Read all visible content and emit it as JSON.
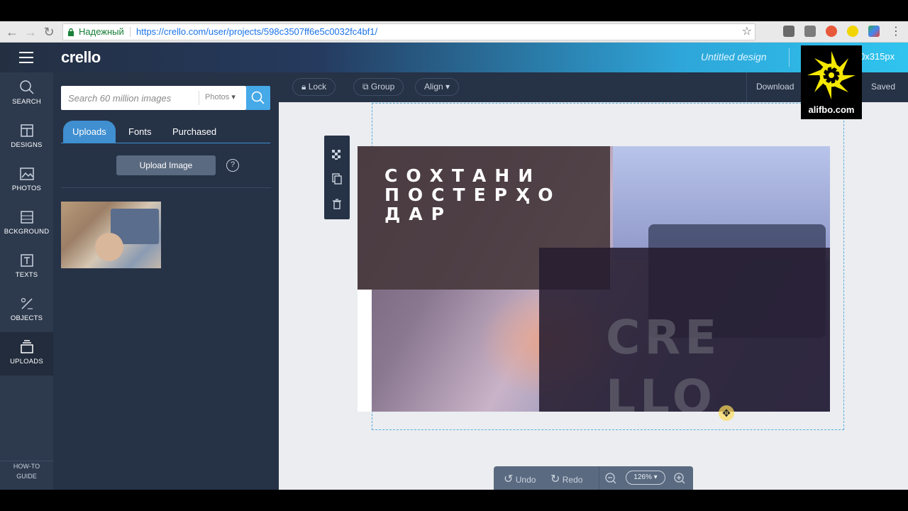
{
  "browser": {
    "secure_label": "Надежный",
    "url": "https://crello.com/user/projects/598c3507ff6e5c0032fc4bf1/"
  },
  "header": {
    "logo": "crello",
    "design_name": "Untitled design",
    "size_label": "0x315px"
  },
  "sidebar": {
    "items": [
      {
        "label": "SEARCH",
        "icon": "search-icon"
      },
      {
        "label": "DESIGNS",
        "icon": "designs-icon"
      },
      {
        "label": "PHOTOS",
        "icon": "photos-icon"
      },
      {
        "label": "BCKGROUND",
        "icon": "background-icon"
      },
      {
        "label": "TEXTS",
        "icon": "texts-icon"
      },
      {
        "label": "OBJECTS",
        "icon": "objects-icon"
      },
      {
        "label": "UPLOADS",
        "icon": "uploads-icon"
      }
    ],
    "howto_line1": "HOW-TO",
    "howto_line2": "GUIDE"
  },
  "panel": {
    "search_placeholder": "Search 60 million images",
    "filter_value": "Photos",
    "tabs": [
      {
        "label": "Uploads",
        "active": true
      },
      {
        "label": "Fonts",
        "active": false
      },
      {
        "label": "Purchased",
        "active": false
      }
    ],
    "upload_button": "Upload Image",
    "help_symbol": "?"
  },
  "toolbar": {
    "lock": "Lock",
    "group": "Group",
    "align": "Align",
    "download": "Download",
    "saved": "Saved"
  },
  "design": {
    "title_line1": "СОХТАНИ",
    "title_line2": "ПОСТЕРҲО",
    "title_line3": "ДАР",
    "brand_line1": "CRE",
    "brand_line2": "LLO"
  },
  "zoom": {
    "undo": "Undo",
    "redo": "Redo",
    "value": "126%"
  },
  "watermark": {
    "label": "alifbo.com"
  },
  "colors": {
    "accent": "#46a9e8",
    "panel_bg": "#263246",
    "sidebar_bg": "#2d3a4e",
    "watermark_yellow": "#f5e800"
  }
}
